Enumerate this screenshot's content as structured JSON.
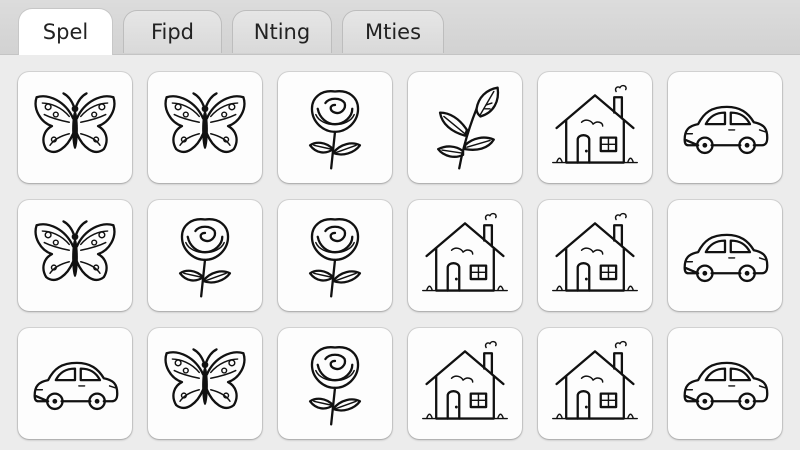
{
  "tabs": [
    {
      "label": "Spel",
      "active": true
    },
    {
      "label": "Fipd",
      "active": false
    },
    {
      "label": "Nting",
      "active": false
    },
    {
      "label": "Mties",
      "active": false
    }
  ],
  "grid": {
    "rows": [
      [
        "butterfly-icon",
        "butterfly-icon",
        "rose-icon",
        "leaf-icon",
        "house-icon",
        "car-icon"
      ],
      [
        "butterfly-icon",
        "rose-icon",
        "rose-icon",
        "house-icon",
        "house-icon",
        "car-icon"
      ],
      [
        "car-icon",
        "butterfly-icon",
        "rose-icon",
        "house-icon",
        "house-icon",
        "car-icon"
      ]
    ]
  },
  "colors": {
    "tabbar": "#d6d6d6",
    "active_tab": "#ffffff",
    "card": "#fdfdfd",
    "ink": "#111111"
  }
}
